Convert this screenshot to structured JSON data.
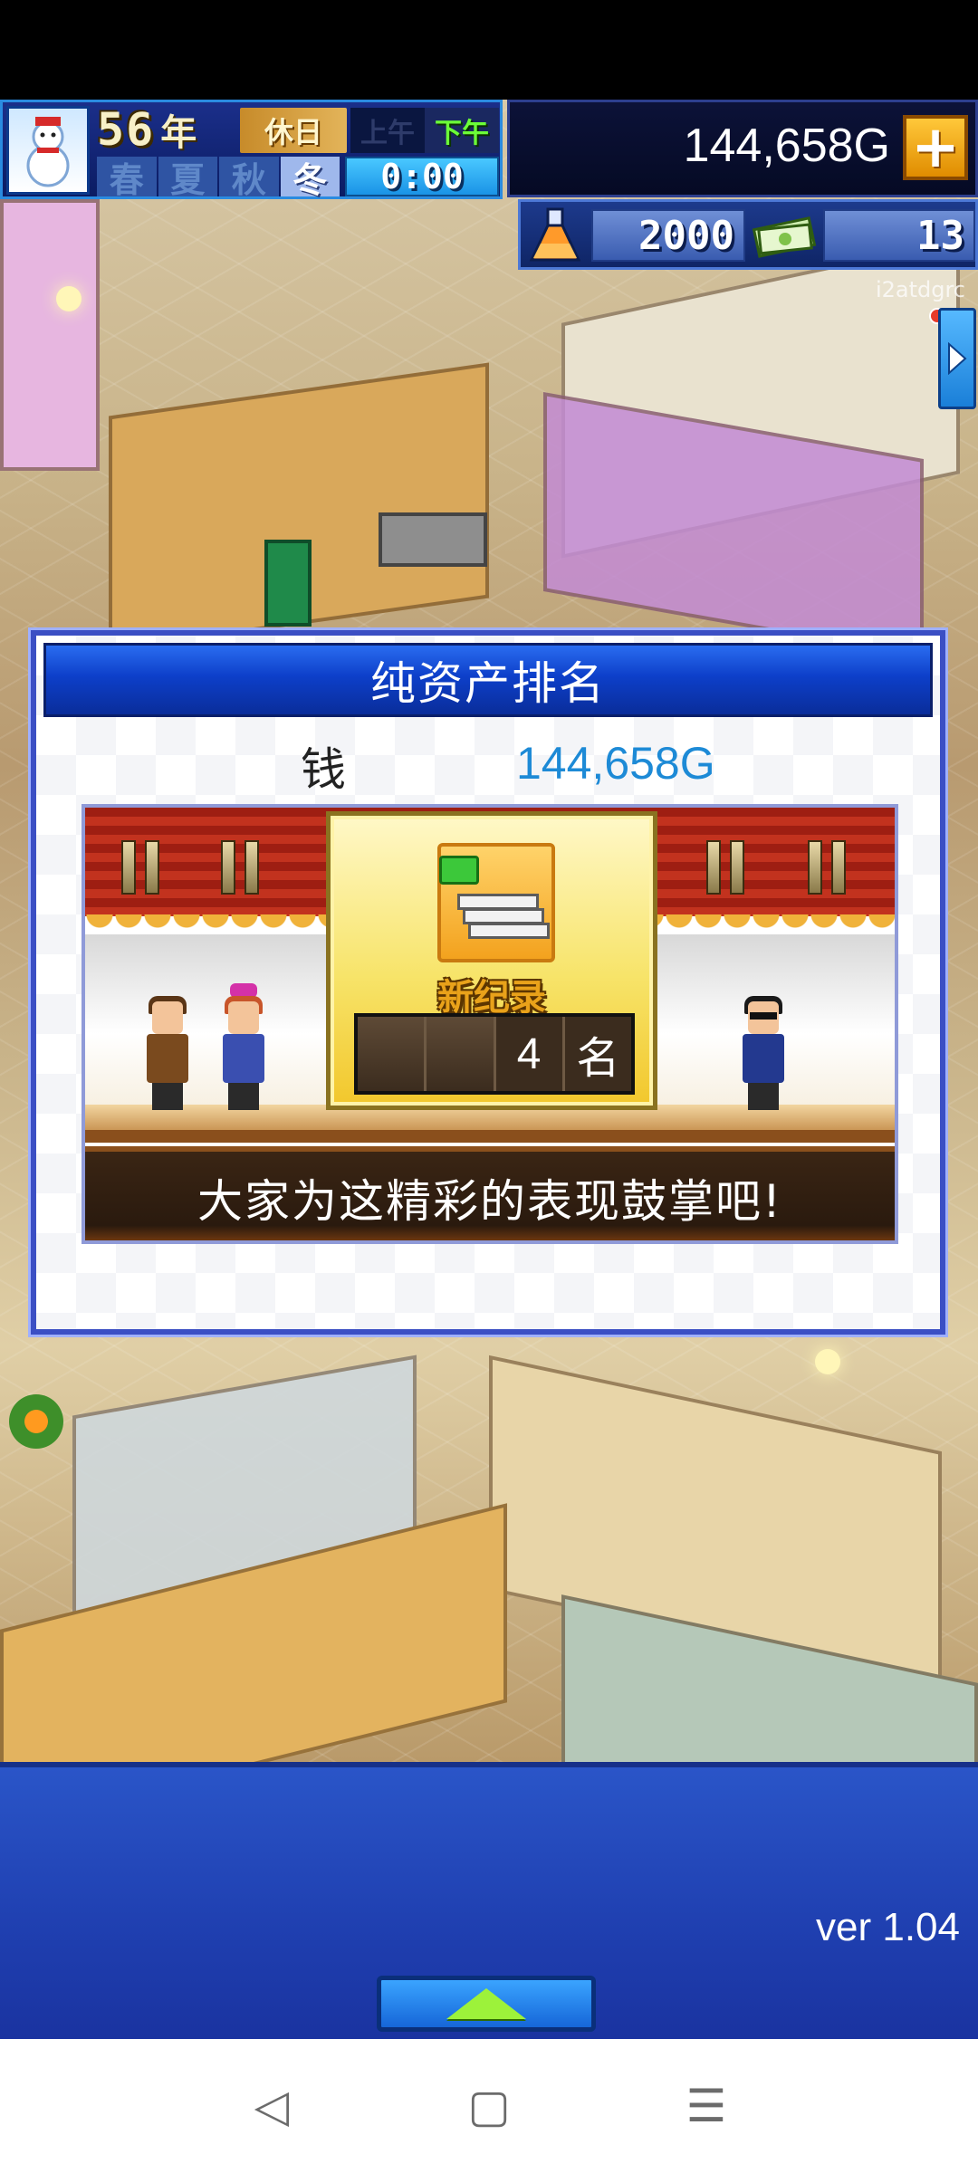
{
  "hud": {
    "year_number": "56",
    "year_unit": "年",
    "day_type": "休日",
    "am": "上午",
    "pm": "下午",
    "seasons": [
      "春",
      "夏",
      "秋",
      "冬"
    ],
    "active_season": "冬",
    "time": "0:00",
    "money": "144,658G",
    "plus": "+",
    "research_points": "2000",
    "tickets": "13",
    "user_tag": "i2atdgrc",
    "avatar_icon": "snowman-icon"
  },
  "dialog": {
    "title": "纯资产排名",
    "money_label": "钱",
    "money_value": "144,658G",
    "new_record": "新纪录",
    "rank_number": "4",
    "rank_unit": "名",
    "message": "大家为这精彩的表现鼓掌吧!"
  },
  "footer": {
    "version": "ver 1.04"
  },
  "nav": {
    "back": "◁",
    "home": "▢",
    "menu": "☰"
  },
  "colors": {
    "accent_blue": "#1d8ad6",
    "dialog_border": "#3b4fc4",
    "pm_green": "#6cff38"
  }
}
